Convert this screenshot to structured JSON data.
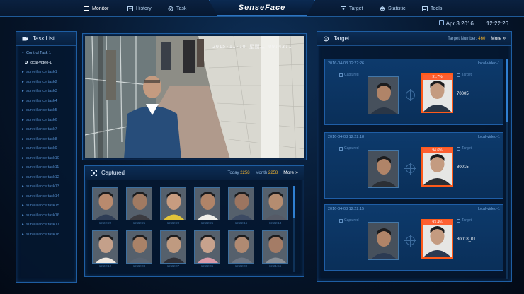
{
  "nav": {
    "monitor": "Monitor",
    "history": "History",
    "task": "Task",
    "target": "Target",
    "statistic": "Statistic",
    "tools": "Tools"
  },
  "logo": "SenseFace",
  "datetime": {
    "date": "Apr 3 2016",
    "time": "12:22:26"
  },
  "task_list": {
    "title": "Task List",
    "items": [
      "Control Task 1",
      "local-video-1",
      "surveillance task1",
      "surveillance task2",
      "surveillance task3",
      "surveillance task4",
      "surveillance task5",
      "surveillance task6",
      "surveillance task7",
      "surveillance task8",
      "surveillance task9",
      "surveillance task10",
      "surveillance task11",
      "surveillance task12",
      "surveillance task13",
      "surveillance task14",
      "surveillance task15",
      "surveillance task16",
      "surveillance task17",
      "surveillance task18"
    ]
  },
  "video": {
    "timestamp": "2015-11-10  星期二  09:43:1"
  },
  "captured": {
    "title": "Captured",
    "today_label": "Today",
    "today_value": "2258",
    "month_label": "Month",
    "month_value": "2258",
    "more": "More",
    "times": [
      "12:22:22",
      "12:22:21",
      "12:22:20",
      "12:22:21",
      "12:22:15",
      "12:22:14",
      "12:22:12",
      "12:22:08",
      "12:22:07",
      "12:22:05",
      "12:22:00",
      "12:21:55"
    ]
  },
  "target": {
    "title": "Target",
    "number_label": "Target Number:",
    "number_value": "460",
    "more": "More",
    "captured_label": "Captured",
    "target_label": "Target",
    "matches": [
      {
        "time": "2016-04-03 12:22:26",
        "source": "local-video-1",
        "score": "91.7%",
        "id": "70005"
      },
      {
        "time": "2016-04-03 12:22:18",
        "source": "local-video-1",
        "score": "94.6%",
        "id": "80015"
      },
      {
        "time": "2016-04-03 12:22:15",
        "source": "local-video-1",
        "score": "93.4%",
        "id": "80018_01"
      }
    ]
  }
}
